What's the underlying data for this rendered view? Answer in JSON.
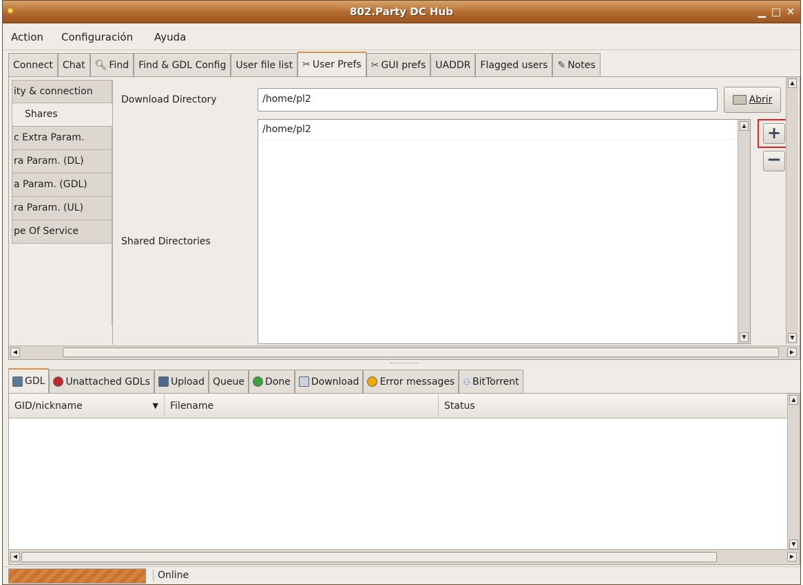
{
  "window": {
    "title": "802.Party DC Hub",
    "app_icon": "app-logo-icon",
    "controls": [
      "minimize-icon",
      "maximize-icon",
      "close-icon"
    ]
  },
  "menubar": {
    "items": [
      {
        "label": "Action"
      },
      {
        "label": "Configuración"
      },
      {
        "label": "Ayuda"
      }
    ]
  },
  "top_tabs": [
    {
      "label": "Connect",
      "icon": ""
    },
    {
      "label": "Chat",
      "icon": ""
    },
    {
      "label": "Find",
      "icon": "find-icon"
    },
    {
      "label": "Find & GDL Config",
      "icon": ""
    },
    {
      "label": "User file list",
      "icon": ""
    },
    {
      "label": "User Prefs",
      "icon": "tools-icon",
      "active": true
    },
    {
      "label": "GUI prefs",
      "icon": "tools-icon"
    },
    {
      "label": "UADDR",
      "icon": ""
    },
    {
      "label": "Flagged users",
      "icon": ""
    },
    {
      "label": "Notes",
      "icon": "notes-icon"
    }
  ],
  "side_tabs": [
    {
      "label": "ity & connection"
    },
    {
      "label": "Shares",
      "active": true
    },
    {
      "label": "c Extra Param."
    },
    {
      "label": "ra Param. (DL)"
    },
    {
      "label": "a Param. (GDL)"
    },
    {
      "label": "ra Param. (UL)"
    },
    {
      "label": "pe Of Service"
    }
  ],
  "shares": {
    "download_label": "Download Directory",
    "download_value": "/home/pl2",
    "open_button": "Abrir",
    "shared_label": "Shared Directories",
    "shared_dirs": [
      "/home/pl2"
    ],
    "add_symbol": "+",
    "remove_symbol": "−"
  },
  "bottom_tabs": [
    {
      "label": "GDL",
      "icon": "gdl-icon",
      "color": "#5b7a9a",
      "active": true
    },
    {
      "label": "Unattached GDLs",
      "icon": "red-circle-icon",
      "color": "#c0282a"
    },
    {
      "label": "Upload",
      "icon": "upload-icon",
      "color": "#4a6b8e"
    },
    {
      "label": "Queue",
      "icon": "",
      "color": ""
    },
    {
      "label": "Done",
      "icon": "green-circle-icon",
      "color": "#3aa23a"
    },
    {
      "label": "Download",
      "icon": "download-icon",
      "color": "#8aa0b8"
    },
    {
      "label": "Error messages",
      "icon": "warning-icon",
      "color": "#f0a800"
    },
    {
      "label": "BitTorrent",
      "icon": "bittorrent-icon",
      "color": "#4a79b5"
    }
  ],
  "table": {
    "columns": [
      "GID/nickname",
      "Filename",
      "Status"
    ],
    "rows": []
  },
  "status": {
    "text": "Online",
    "progress": 1.0,
    "progress_color": "#d4843e"
  },
  "scroll_glyphs": {
    "up": "▲",
    "down": "▼",
    "left": "◀",
    "right": "▶"
  }
}
